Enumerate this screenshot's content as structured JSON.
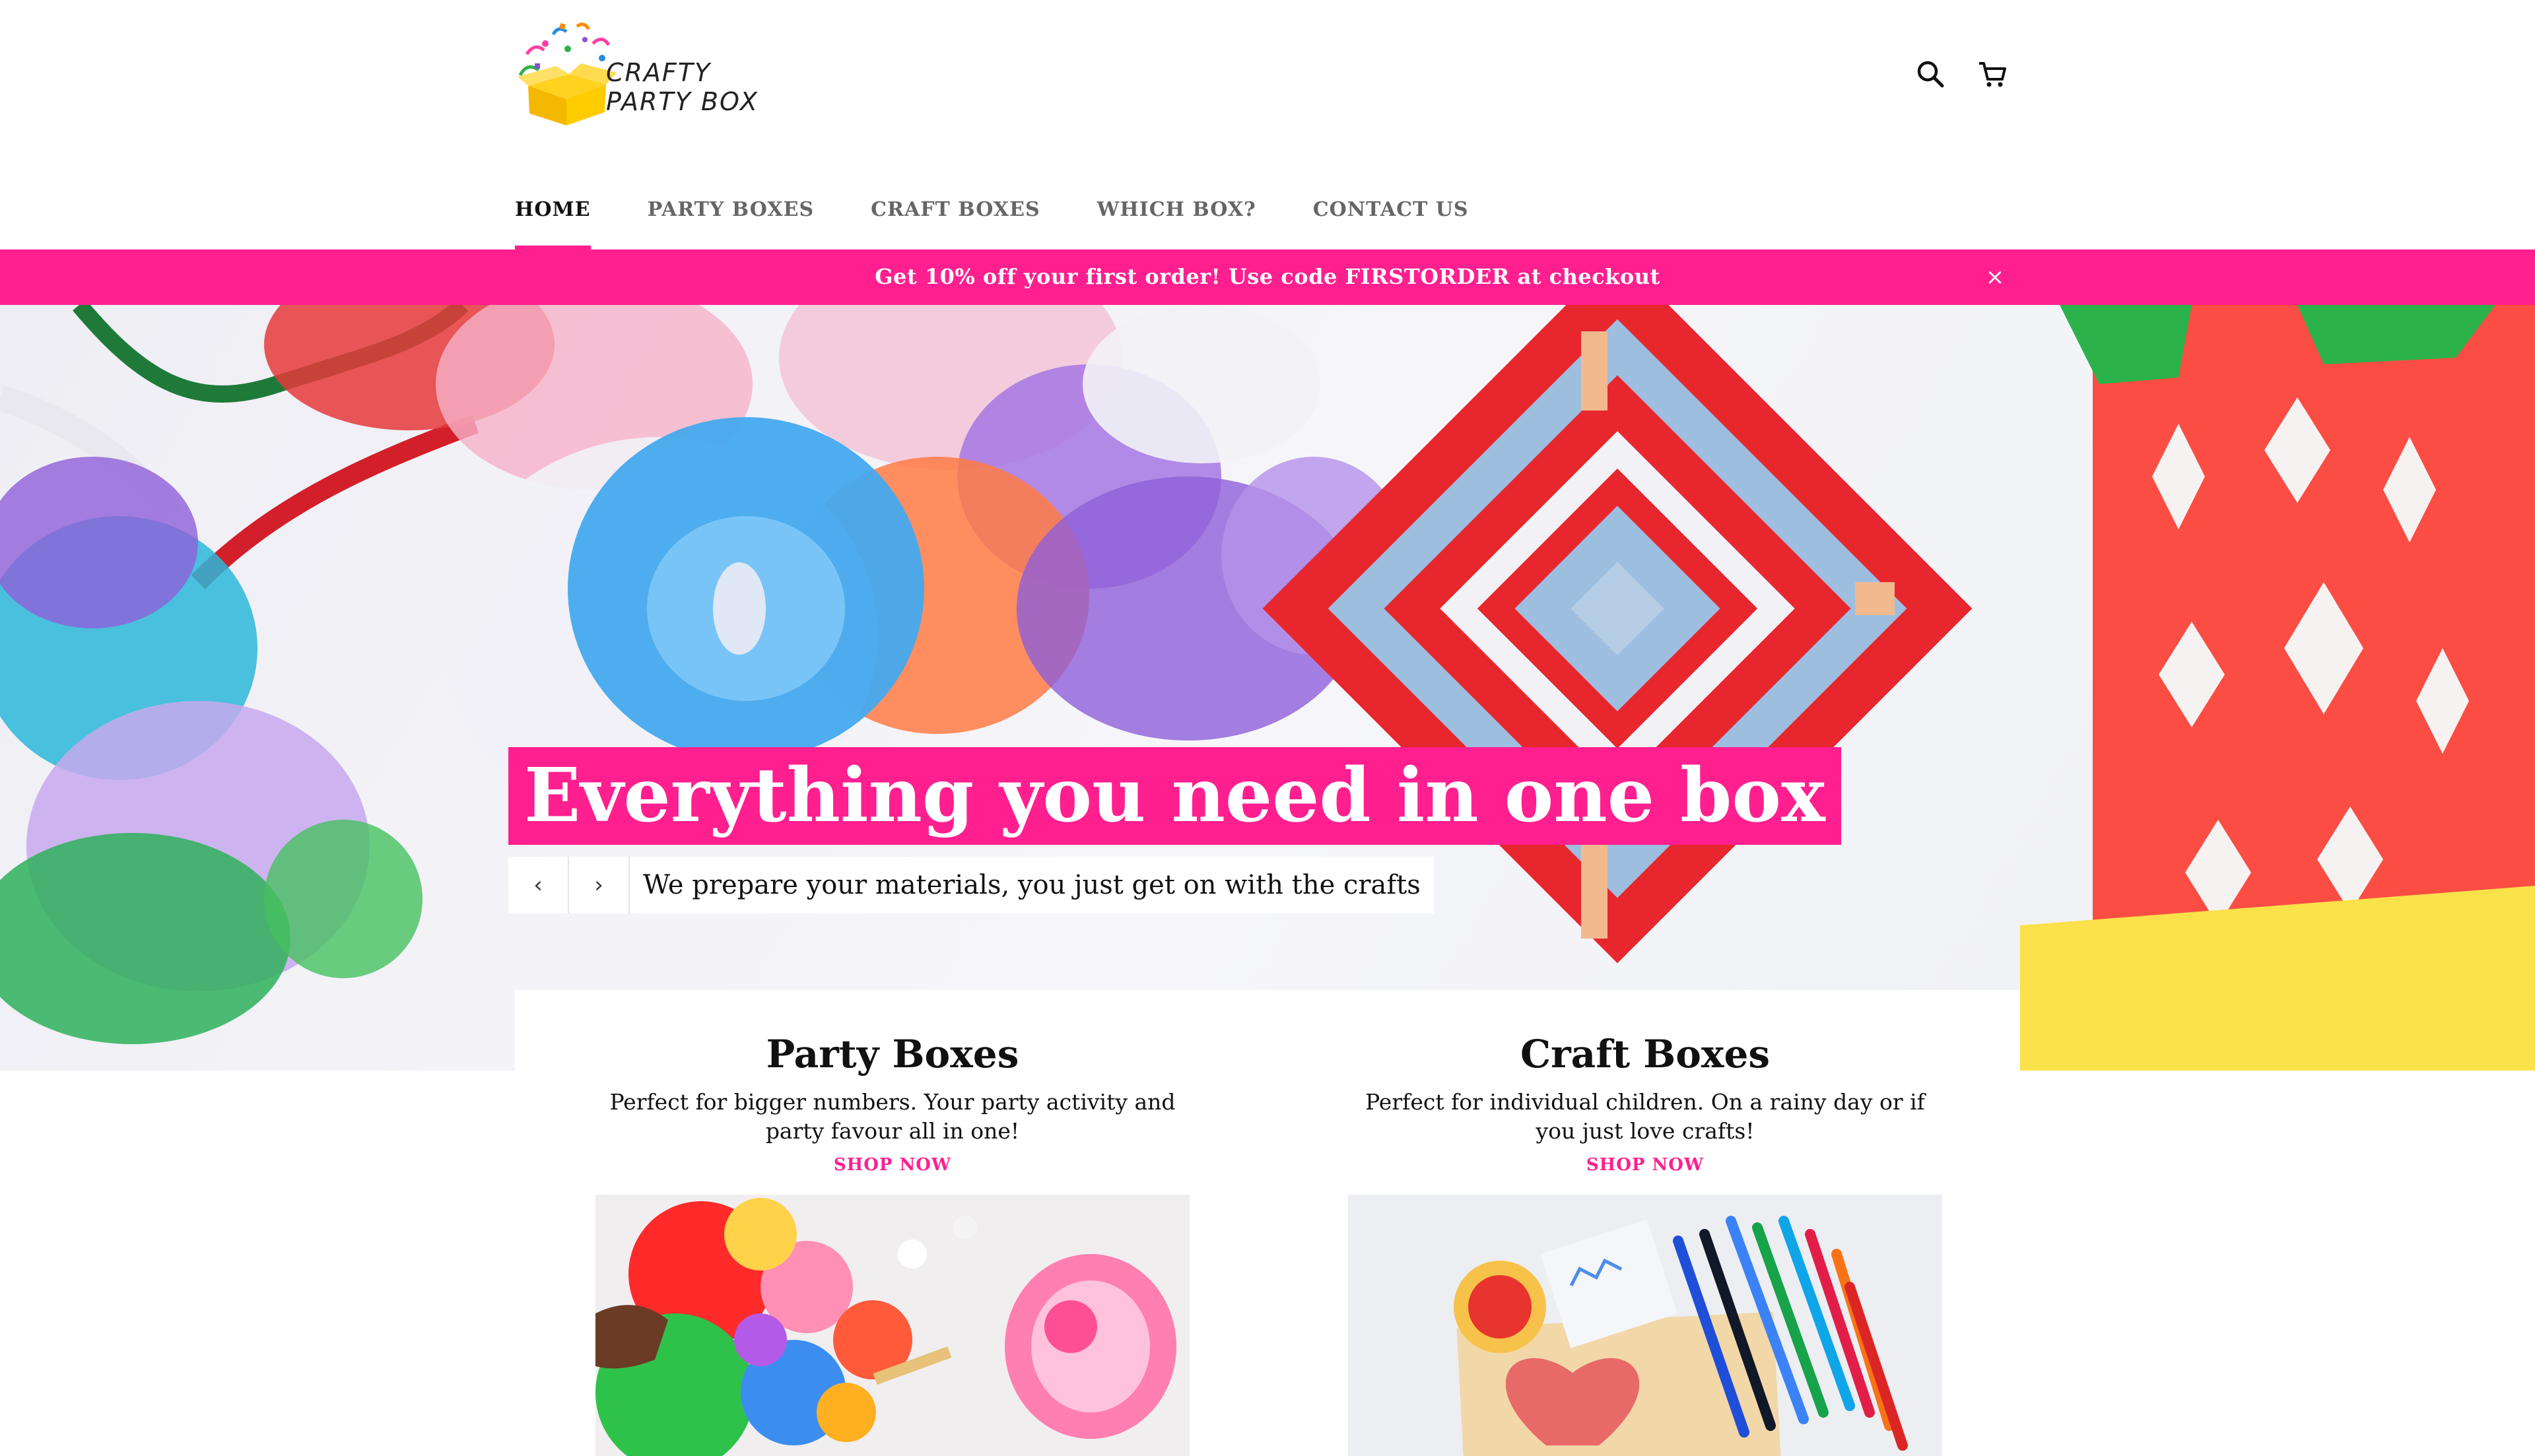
{
  "brand": {
    "logo_text": "CRAFTY\nPARTY BOX",
    "colors": {
      "accent": "#ff1f8f",
      "text": "#111111",
      "muted": "#666666",
      "background": "#ffffff"
    }
  },
  "header": {
    "search_icon": "search-icon",
    "cart_icon": "cart-icon"
  },
  "nav": {
    "items": [
      {
        "label": "HOME",
        "active": true
      },
      {
        "label": "PARTY BOXES",
        "active": false
      },
      {
        "label": "CRAFT BOXES",
        "active": false
      },
      {
        "label": "WHICH BOX?",
        "active": false
      },
      {
        "label": "CONTACT US",
        "active": false
      }
    ]
  },
  "announcement": {
    "text": "Get 10% off your first order! Use code FIRSTORDER at checkout",
    "close_glyph": "×"
  },
  "hero": {
    "title": "Everything you need in one box",
    "subtitle": "We prepare your materials, you just get on with the crafts",
    "prev_glyph": "‹",
    "next_glyph": "›"
  },
  "features": [
    {
      "title": "Party Boxes",
      "description": "Perfect for bigger numbers. Your party activity and party favour all in one!",
      "link": "SHOP NOW"
    },
    {
      "title": "Craft Boxes",
      "description": "Perfect for individual children. On a rainy day or if you just love crafts!",
      "link": "SHOP NOW"
    }
  ]
}
